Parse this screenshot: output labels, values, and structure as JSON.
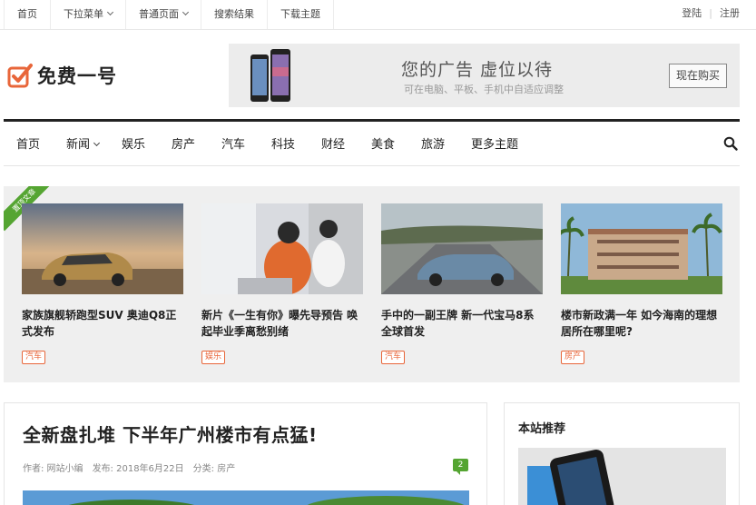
{
  "topbar": {
    "items": [
      {
        "label": "首页"
      },
      {
        "label": "下拉菜单",
        "dropdown": true
      },
      {
        "label": "普通页面",
        "dropdown": true
      },
      {
        "label": "搜索结果"
      },
      {
        "label": "下载主题"
      }
    ],
    "login": "登陆",
    "register": "注册"
  },
  "logo": {
    "text": "免费一号",
    "icon": "checkbox-check-icon",
    "color": "#e8663a"
  },
  "ad": {
    "title": "您的广告 虚位以待",
    "subtitle": "可在电脑、平板、手机中自适应调整",
    "button": "现在购买"
  },
  "mainnav": {
    "items": [
      {
        "label": "首页"
      },
      {
        "label": "新闻",
        "dropdown": true
      },
      {
        "label": "娱乐"
      },
      {
        "label": "房产"
      },
      {
        "label": "汽车"
      },
      {
        "label": "科技"
      },
      {
        "label": "财经"
      },
      {
        "label": "美食"
      },
      {
        "label": "旅游"
      },
      {
        "label": "更多主题"
      }
    ],
    "search_icon": "search-icon"
  },
  "featured": {
    "ribbon": "置顶文章",
    "ribbon_color": "#55a532",
    "cards": [
      {
        "title": "家族旗舰轿跑型SUV 奥迪Q8正式发布",
        "tag": "汽车"
      },
      {
        "title": "新片《一生有你》曝先导预告 唤起毕业季离愁别绪",
        "tag": "娱乐"
      },
      {
        "title": "手中的一副王牌 新一代宝马8系全球首发",
        "tag": "汽车"
      },
      {
        "title": "楼市新政满一年 如今海南的理想居所在哪里呢?",
        "tag": "房产"
      }
    ],
    "tag_color": "#e8663a"
  },
  "article": {
    "title": "全新盘扎堆 下半年广州楼市有点猛!",
    "author": "作者: 网站小编",
    "date": "发布: 2018年6月22日",
    "category": "分类: 房产",
    "comments": "2"
  },
  "sidebar": {
    "title": "本站推荐"
  }
}
